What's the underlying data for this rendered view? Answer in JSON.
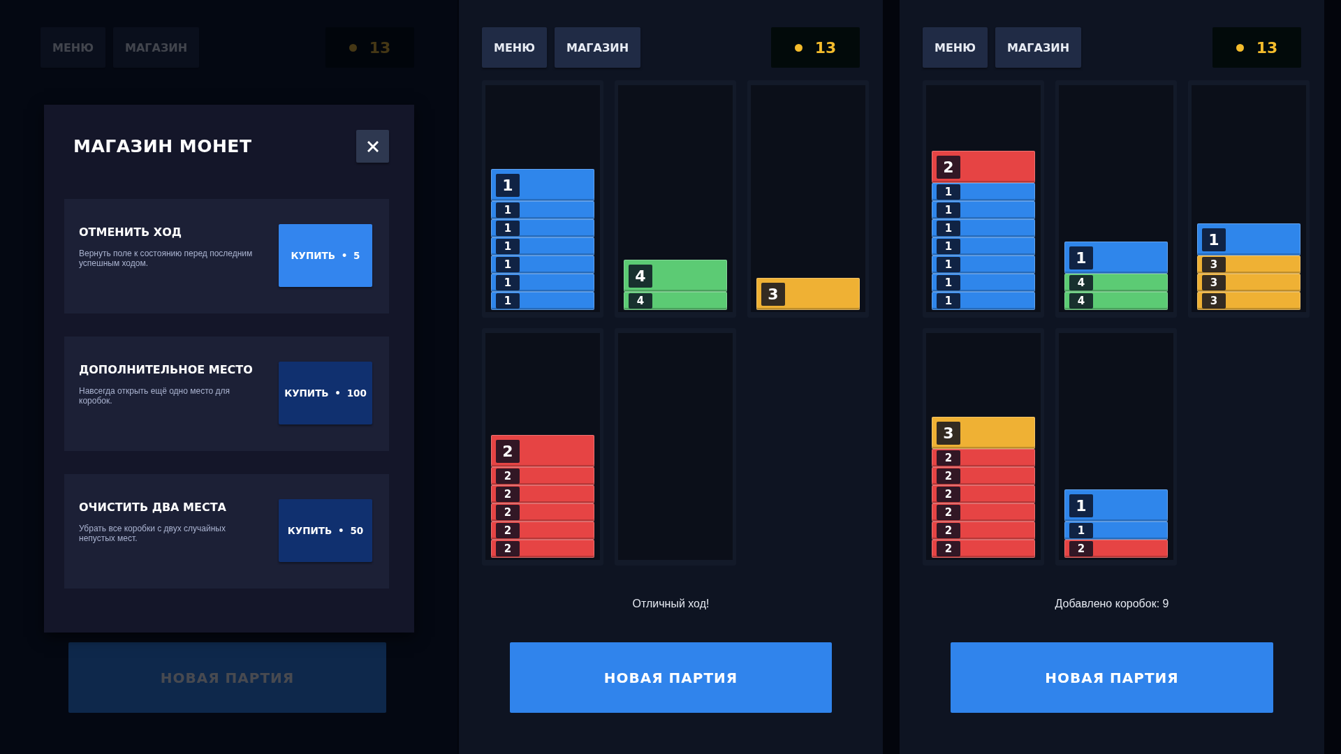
{
  "screens": [
    {
      "header": {
        "menu": "МЕНЮ",
        "shop": "МАГАЗИН",
        "coins": "13"
      },
      "modal": {
        "title": "МАГАЗИН МОНЕТ",
        "items": [
          {
            "title": "ОТМЕНИТЬ ХОД",
            "description": "Вернуть поле к состоянию перед последним успешным ходом.",
            "button": "КУПИТЬ • 5",
            "affordable": true
          },
          {
            "title": "ДОПОЛНИТЕЛЬНОЕ МЕСТО",
            "description": "Навсегда открыть ещё одно место для коробок.",
            "button": "КУПИТЬ • 100",
            "affordable": false
          },
          {
            "title": "ОЧИСТИТЬ ДВА МЕСТА",
            "description": "Убрать все коробки с двух случайных непустых мест.",
            "button": "КУПИТЬ • 50",
            "affordable": false
          }
        ]
      },
      "new_game": "НОВАЯ ПАРТИЯ"
    },
    {
      "header": {
        "menu": "МЕНЮ",
        "shop": "МАГАЗИН",
        "coins": "13"
      },
      "columns": [
        {
          "kind": "stack",
          "boxes": [
            {
              "number": "1",
              "color": "#2f86eb"
            },
            {
              "number": "1",
              "color": "#2f86eb"
            },
            {
              "number": "1",
              "color": "#2f86eb"
            },
            {
              "number": "1",
              "color": "#2f86eb"
            },
            {
              "number": "1",
              "color": "#2f86eb"
            },
            {
              "number": "1",
              "color": "#2f86eb"
            },
            {
              "number": "1",
              "color": "#2f86eb"
            }
          ]
        },
        {
          "kind": "stack",
          "boxes": [
            {
              "number": "4",
              "color": "#5ccb74"
            },
            {
              "number": "4",
              "color": "#5ccb74"
            }
          ]
        },
        {
          "kind": "stack",
          "boxes": [
            {
              "number": "3",
              "color": "#efb134"
            }
          ]
        },
        {
          "kind": "stack",
          "boxes": [
            {
              "number": "2",
              "color": "#e64444"
            },
            {
              "number": "2",
              "color": "#e64444"
            },
            {
              "number": "2",
              "color": "#e64444"
            },
            {
              "number": "2",
              "color": "#e64444"
            },
            {
              "number": "2",
              "color": "#e64444"
            },
            {
              "number": "2",
              "color": "#e64444"
            }
          ]
        },
        {
          "kind": "empty"
        }
      ],
      "message": "Отличный ход!",
      "new_game": "НОВАЯ ПАРТИЯ"
    },
    {
      "header": {
        "menu": "МЕНЮ",
        "shop": "МАГАЗИН",
        "coins": "13"
      },
      "columns": [
        {
          "kind": "stack",
          "boxes": [
            {
              "number": "2",
              "color": "#e64444"
            },
            {
              "number": "1",
              "color": "#2f86eb"
            },
            {
              "number": "1",
              "color": "#2f86eb"
            },
            {
              "number": "1",
              "color": "#2f86eb"
            },
            {
              "number": "1",
              "color": "#2f86eb"
            },
            {
              "number": "1",
              "color": "#2f86eb"
            },
            {
              "number": "1",
              "color": "#2f86eb"
            },
            {
              "number": "1",
              "color": "#2f86eb"
            }
          ]
        },
        {
          "kind": "stack",
          "boxes": [
            {
              "number": "1",
              "color": "#2f86eb"
            },
            {
              "number": "4",
              "color": "#5ccb74"
            },
            {
              "number": "4",
              "color": "#5ccb74"
            }
          ]
        },
        {
          "kind": "stack",
          "boxes": [
            {
              "number": "1",
              "color": "#2f86eb"
            },
            {
              "number": "3",
              "color": "#efb134"
            },
            {
              "number": "3",
              "color": "#efb134"
            },
            {
              "number": "3",
              "color": "#efb134"
            }
          ]
        },
        {
          "kind": "stack",
          "boxes": [
            {
              "number": "3",
              "color": "#efb134"
            },
            {
              "number": "2",
              "color": "#e64444"
            },
            {
              "number": "2",
              "color": "#e64444"
            },
            {
              "number": "2",
              "color": "#e64444"
            },
            {
              "number": "2",
              "color": "#e64444"
            },
            {
              "number": "2",
              "color": "#e64444"
            },
            {
              "number": "2",
              "color": "#e64444"
            }
          ]
        },
        {
          "kind": "stack",
          "boxes": [
            {
              "number": "1",
              "color": "#2f86eb"
            },
            {
              "number": "1",
              "color": "#2f86eb"
            },
            {
              "number": "2",
              "color": "#e64444"
            }
          ]
        }
      ],
      "message": "Добавлено коробок: 9",
      "new_game": "НОВАЯ ПАРТИЯ"
    }
  ]
}
